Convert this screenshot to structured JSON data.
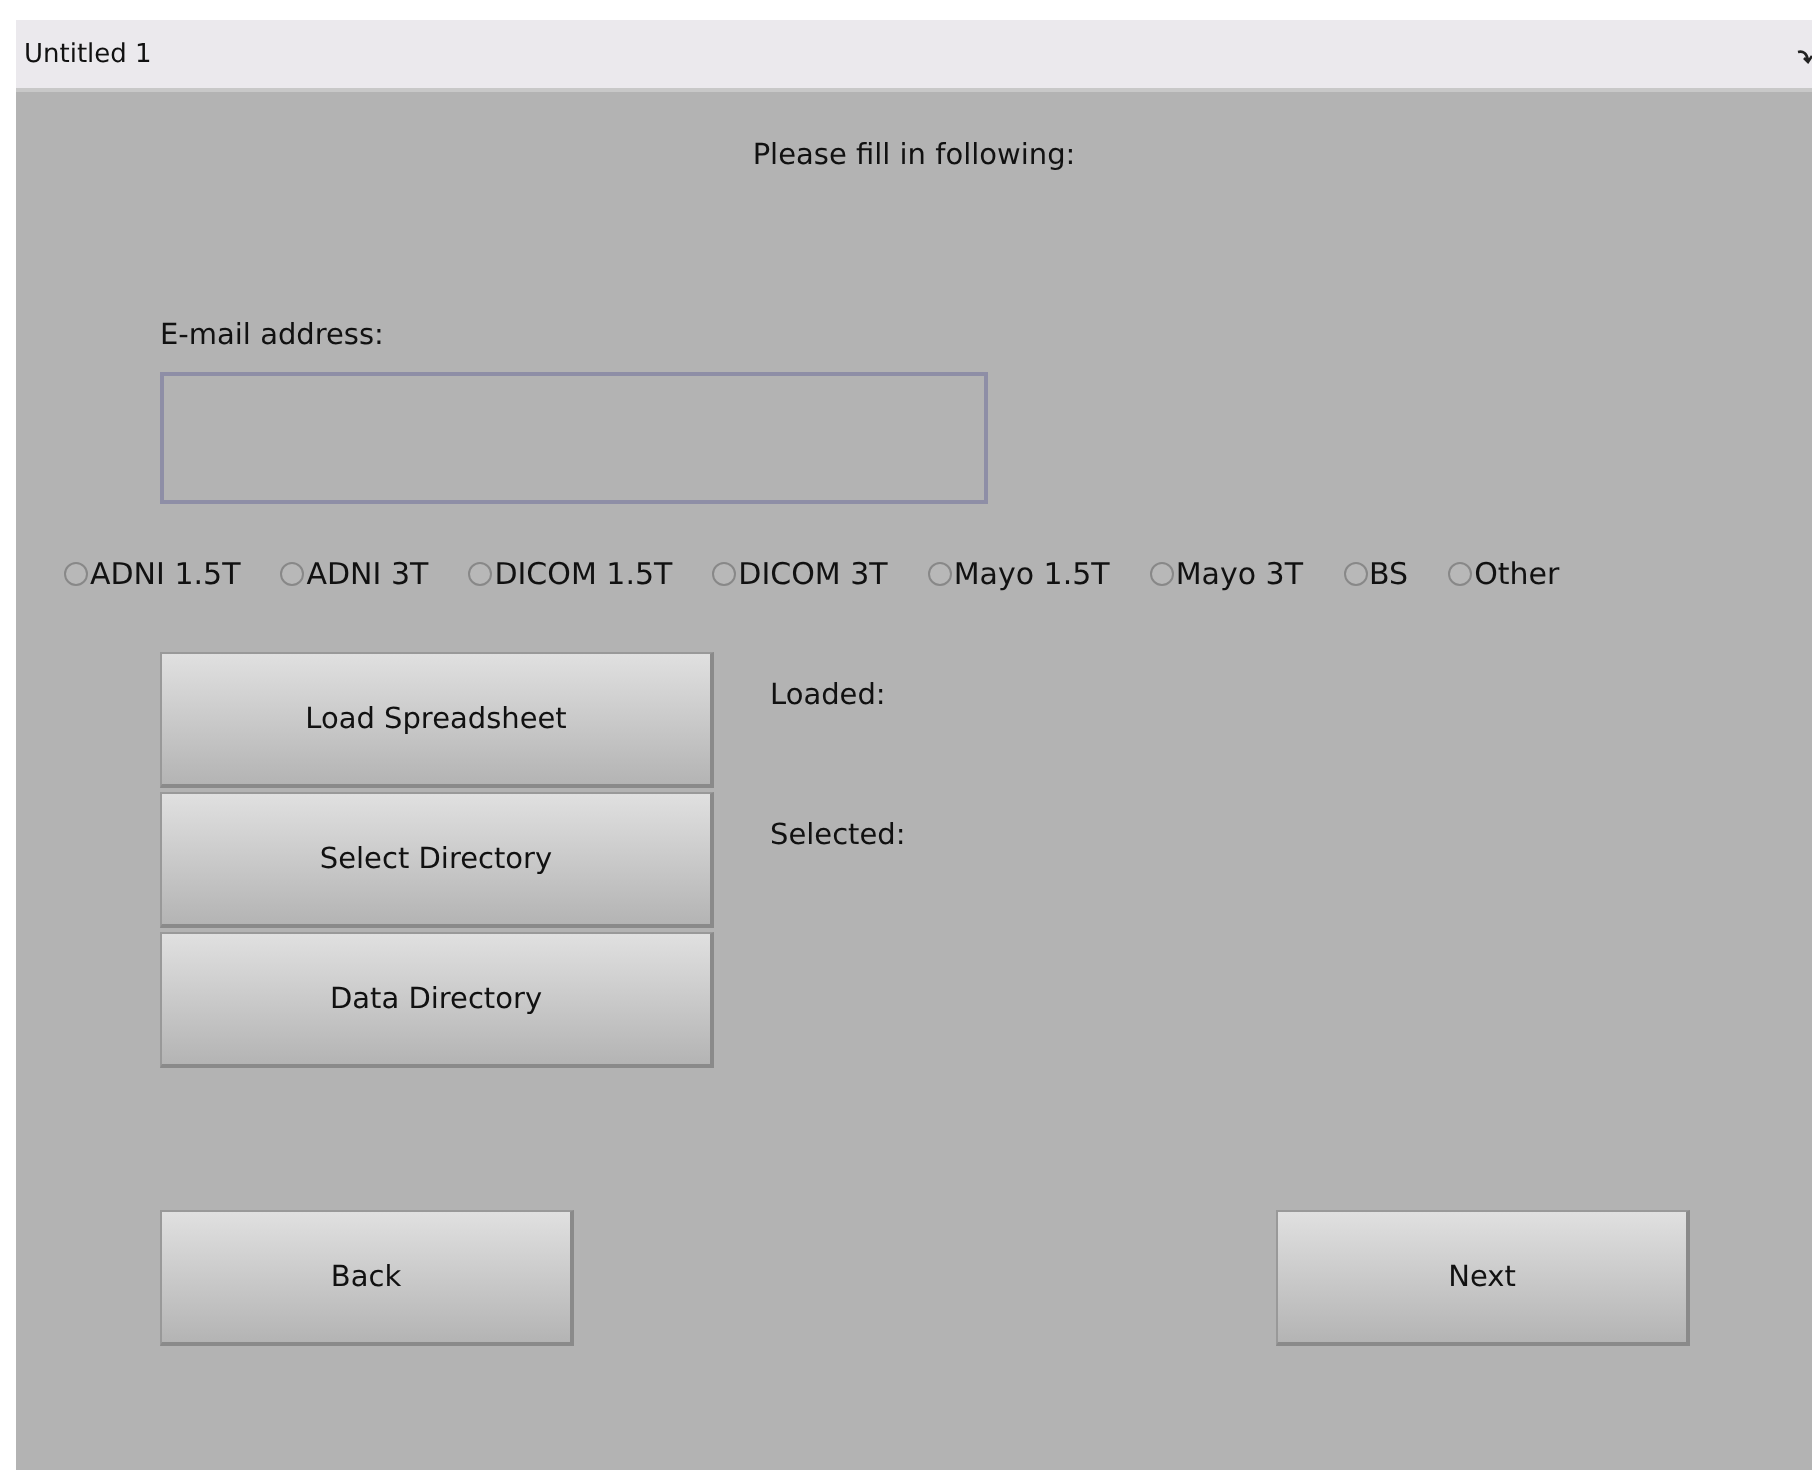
{
  "window": {
    "title": "Untitled 1"
  },
  "heading": "Please fill in following:",
  "email": {
    "label": "E-mail address:"
  },
  "options": [
    {
      "label": "ADNI 1.5T",
      "selected": false
    },
    {
      "label": "ADNI 3T",
      "selected": false
    },
    {
      "label": "DICOM 1.5T",
      "selected": false
    },
    {
      "label": "DICOM 3T",
      "selected": false
    },
    {
      "label": "Mayo 1.5T",
      "selected": false
    },
    {
      "label": "Mayo 3T",
      "selected": false
    },
    {
      "label": "BS",
      "selected": false
    },
    {
      "label": "Other",
      "selected": false
    }
  ],
  "actions": [
    {
      "button": "Load Spreadsheet",
      "status": "Loaded:"
    },
    {
      "button": "Select Directory",
      "status": "Selected:"
    },
    {
      "button": "Data Directory"
    }
  ],
  "nav": [
    "Back",
    "Next"
  ]
}
